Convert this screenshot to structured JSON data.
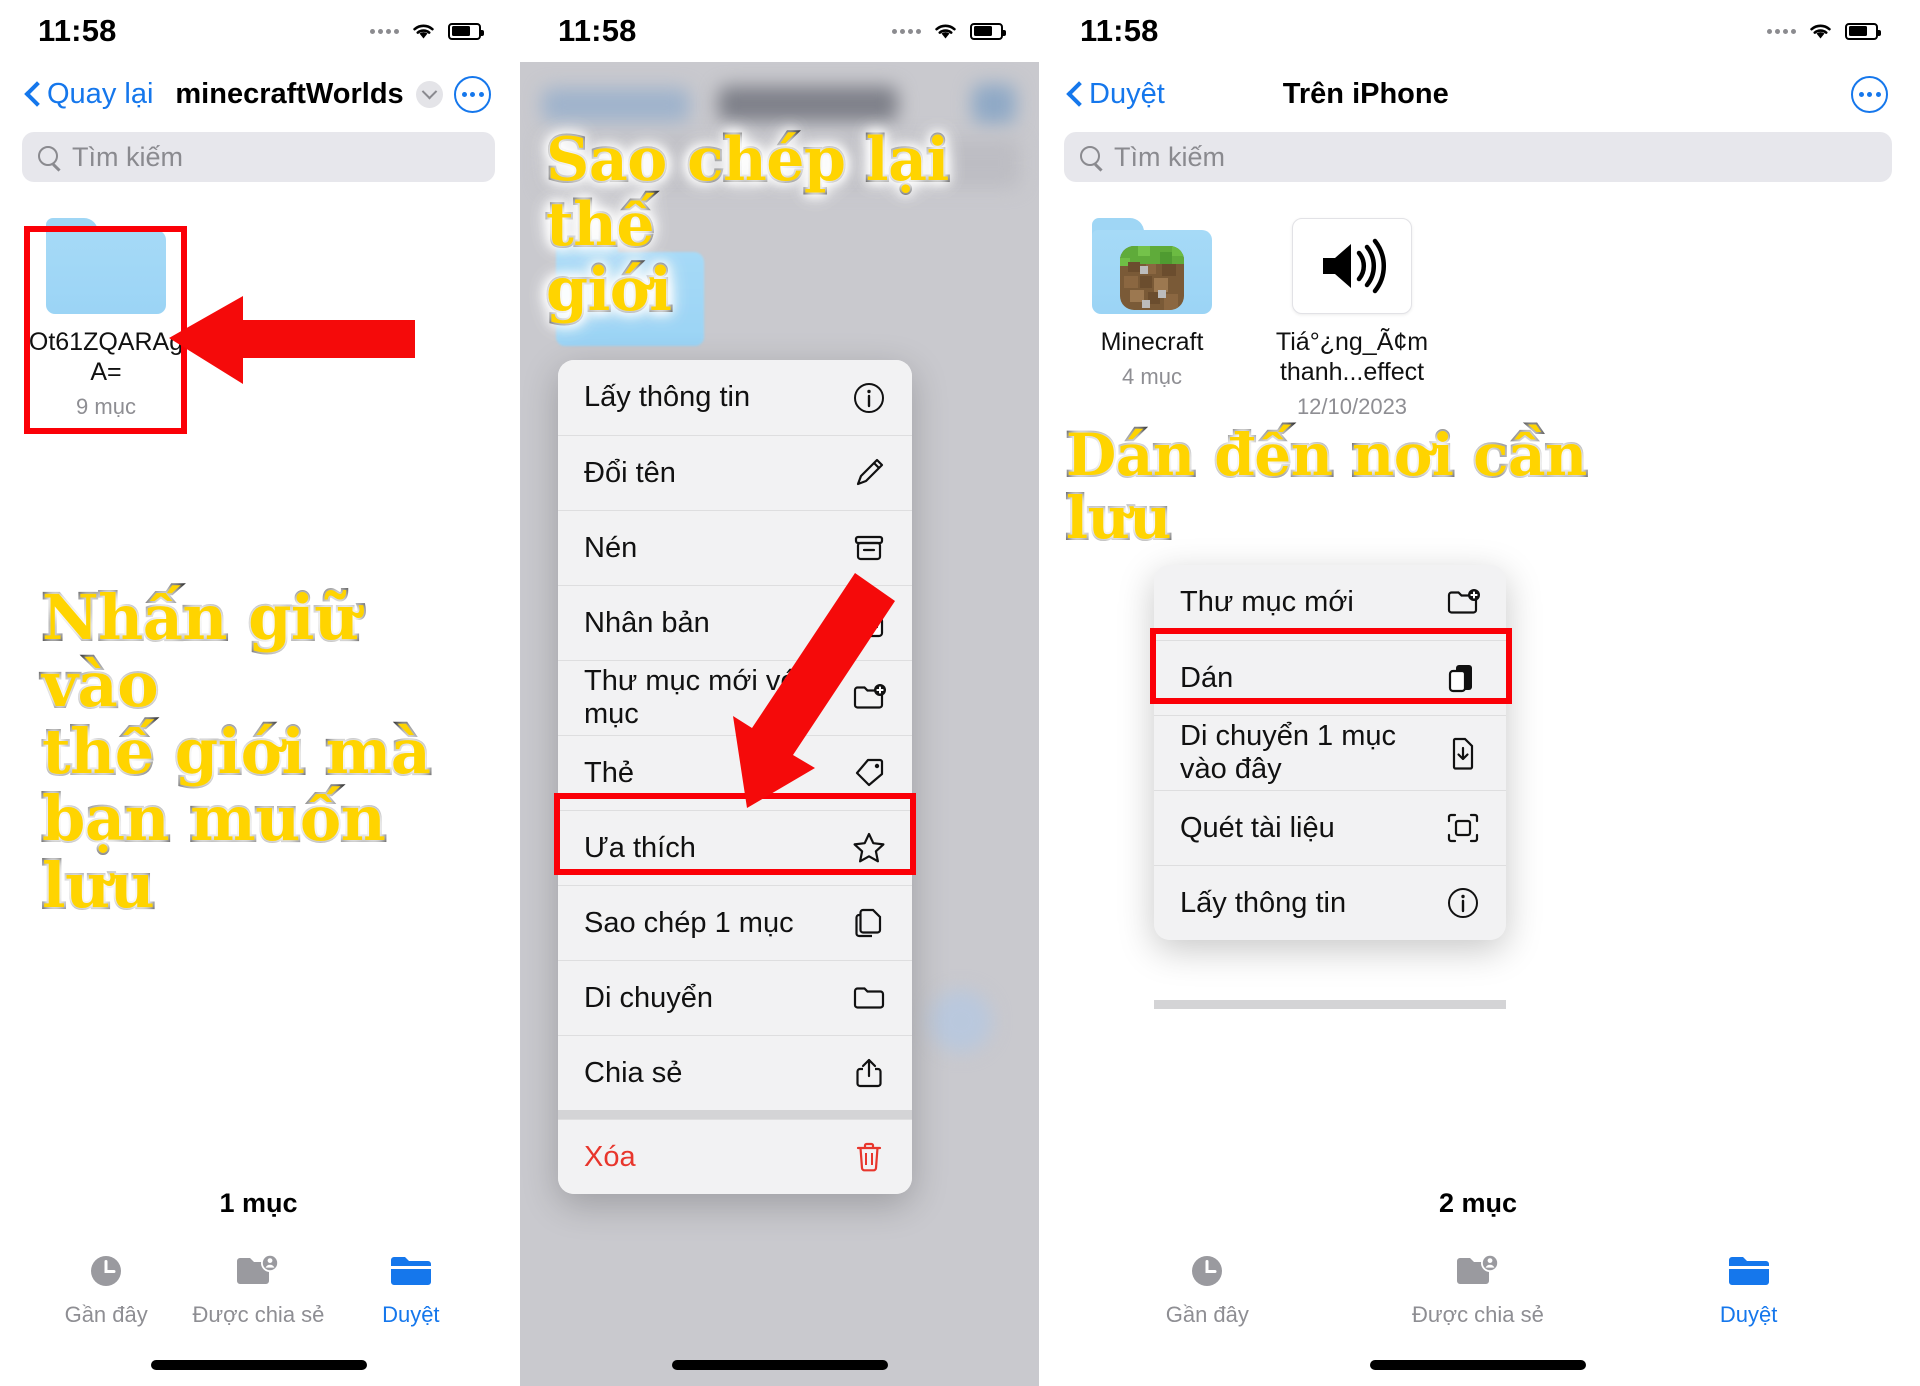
{
  "status": {
    "time": "11:58"
  },
  "panel1": {
    "nav": {
      "back_label": "Quay lại",
      "title": "minecraftWorlds",
      "more_icon": "ellipsis-icon",
      "chevron_icon": "chevron-down-icon"
    },
    "search": {
      "placeholder": "Tìm kiếm",
      "icon": "search-icon"
    },
    "files": [
      {
        "name": "Ot61ZQARAgA=",
        "sub": "9 mục",
        "icon": "folder-icon"
      }
    ],
    "caption": "Nhấn giữ vào\nthế giới mà\nbạn muốn lưu",
    "item_count": "1 mục",
    "tabs": [
      {
        "label": "Gần đây",
        "icon": "clock-icon",
        "active": false
      },
      {
        "label": "Được chia sẻ",
        "icon": "shared-folder-icon",
        "active": false
      },
      {
        "label": "Duyệt",
        "icon": "folder-icon",
        "active": true
      }
    ]
  },
  "panel2": {
    "caption": "Sao chép lại thế\ngiới",
    "menu": [
      {
        "label": "Lấy thông tin",
        "icon": "info-circle-icon",
        "highlighted": false,
        "destructive": false
      },
      {
        "label": "Đổi tên",
        "icon": "pencil-icon",
        "highlighted": false,
        "destructive": false
      },
      {
        "label": "Nén",
        "icon": "archive-box-icon",
        "highlighted": false,
        "destructive": false
      },
      {
        "label": "Nhân bản",
        "icon": "duplicate-icon",
        "highlighted": false,
        "destructive": false
      },
      {
        "label": "Thư mục mới với 1 mục",
        "icon": "new-folder-icon",
        "highlighted": false,
        "destructive": false
      },
      {
        "label": "Thẻ",
        "icon": "tag-icon",
        "highlighted": false,
        "destructive": false
      },
      {
        "label": "Ưa thích",
        "icon": "star-icon",
        "highlighted": false,
        "destructive": false
      },
      {
        "label": "Sao chép 1 mục",
        "icon": "copy-icon",
        "highlighted": true,
        "destructive": false
      },
      {
        "label": "Di chuyển",
        "icon": "folder-icon",
        "highlighted": false,
        "destructive": false
      },
      {
        "label": "Chia sẻ",
        "icon": "share-icon",
        "highlighted": false,
        "destructive": false
      },
      {
        "label": "Xóa",
        "icon": "trash-icon",
        "highlighted": false,
        "destructive": true
      }
    ]
  },
  "panel3": {
    "nav": {
      "back_label": "Duyệt",
      "title": "Trên iPhone",
      "more_icon": "ellipsis-icon"
    },
    "search": {
      "placeholder": "Tìm kiếm",
      "icon": "search-icon"
    },
    "files": [
      {
        "name": "Minecraft",
        "sub": "4 mục",
        "icon": "minecraft-folder-icon"
      },
      {
        "name": "Tiá°¿ng_Ã¢m thanh...effect",
        "sub": "12/10/2023",
        "icon": "audio-file-icon"
      }
    ],
    "caption": "Dán đến nơi cần\nlưu",
    "menu": [
      {
        "label": "Thư mục mới",
        "icon": "new-folder-icon",
        "highlighted": false
      },
      {
        "label": "Dán",
        "icon": "paste-icon",
        "highlighted": true
      },
      {
        "label": "Di chuyển 1 mục vào đây",
        "icon": "move-in-icon",
        "highlighted": false
      },
      {
        "label": "Quét tài liệu",
        "icon": "scan-doc-icon",
        "highlighted": false
      },
      {
        "label": "Lấy thông tin",
        "icon": "info-circle-icon",
        "highlighted": false
      }
    ],
    "item_count": "2 mục",
    "tabs": [
      {
        "label": "Gần đây",
        "icon": "clock-icon",
        "active": false
      },
      {
        "label": "Được chia sẻ",
        "icon": "shared-folder-icon",
        "active": false
      },
      {
        "label": "Duyệt",
        "icon": "folder-icon",
        "active": true
      }
    ]
  },
  "colors": {
    "accent": "#1577ec",
    "highlight": "#fb0007",
    "caption_fill": "#FFD400",
    "destructive": "#e8362c"
  }
}
